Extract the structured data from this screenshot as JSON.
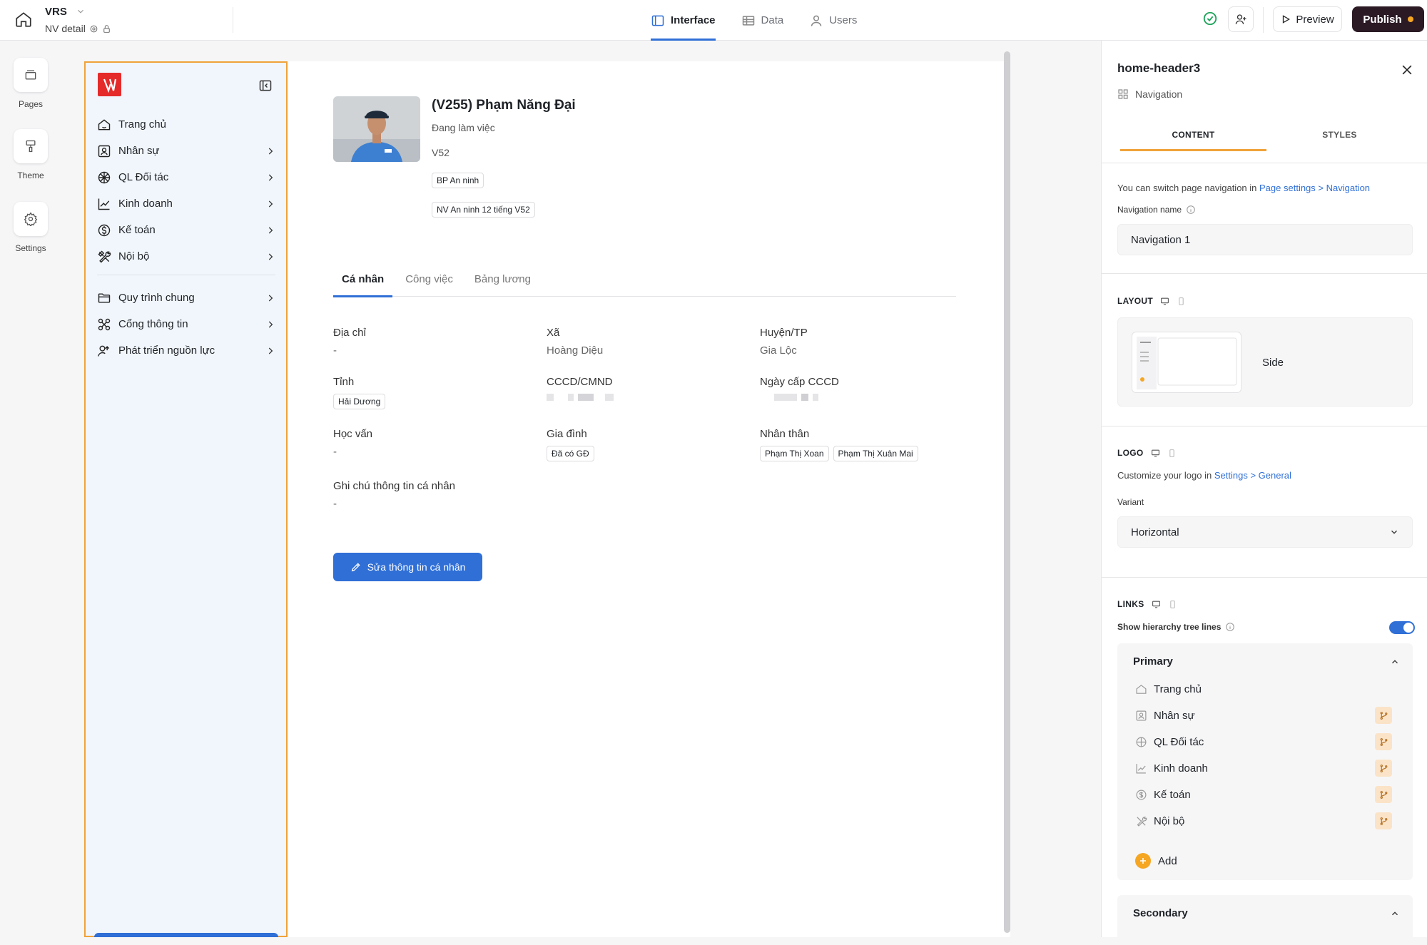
{
  "topbar": {
    "app_name": "VRS",
    "page_name": "NV detail",
    "tabs": [
      {
        "label": "Interface",
        "icon": "layout-icon",
        "active": true
      },
      {
        "label": "Data",
        "icon": "table-icon",
        "active": false
      },
      {
        "label": "Users",
        "icon": "user-icon",
        "active": false
      }
    ],
    "preview_label": "Preview",
    "publish_label": "Publish"
  },
  "rail": {
    "pages": "Pages",
    "theme": "Theme",
    "settings": "Settings"
  },
  "sidenav": {
    "primary": [
      {
        "label": "Trang chủ",
        "icon": "home-icon",
        "chevron": false
      },
      {
        "label": "Nhân sự",
        "icon": "id-card-icon",
        "chevron": true
      },
      {
        "label": "QL Đối tác",
        "icon": "network-icon",
        "chevron": true
      },
      {
        "label": "Kinh doanh",
        "icon": "trend-icon",
        "chevron": true
      },
      {
        "label": "Kế toán",
        "icon": "dollar-icon",
        "chevron": true
      },
      {
        "label": "Nội bộ",
        "icon": "tools-icon",
        "chevron": true
      }
    ],
    "secondary": [
      {
        "label": "Quy trình chung",
        "icon": "folder-icon",
        "chevron": true
      },
      {
        "label": "Cổng thông tin",
        "icon": "hub-icon",
        "chevron": true
      },
      {
        "label": "Phát triển nguồn lực",
        "icon": "user-growth-icon",
        "chevron": true
      }
    ]
  },
  "profile": {
    "name": "(V255) Phạm Năng Đại",
    "status": "Đang làm việc",
    "code": "V52",
    "chips": [
      "BP An ninh",
      "NV An ninh 12 tiếng V52"
    ]
  },
  "profile_tabs": [
    "Cá nhân",
    "Công việc",
    "Bảng lương"
  ],
  "fields": {
    "dia_chi": {
      "label": "Địa chỉ",
      "value": "-"
    },
    "xa": {
      "label": "Xã",
      "value": "Hoàng Diệu"
    },
    "huyen": {
      "label": "Huyện/TP",
      "value": "Gia Lộc"
    },
    "tinh": {
      "label": "Tỉnh",
      "value": "Hải Dương"
    },
    "cccd": {
      "label": "CCCD/CMND"
    },
    "ngay_cap": {
      "label": "Ngày cấp CCCD"
    },
    "hoc_van": {
      "label": "Học vấn",
      "value": "-"
    },
    "gia_dinh": {
      "label": "Gia đình",
      "value": "Đã có GĐ"
    },
    "nhan_than": {
      "label": "Nhân thân",
      "values": [
        "Phạm Thị Xoan",
        "Phạm Thị Xuân Mai"
      ]
    },
    "ghi_chu": {
      "label": "Ghi chú thông tin cá nhân",
      "value": "-"
    }
  },
  "edit_button": "Sửa thông tin cá nhân",
  "panel": {
    "title": "home-header3",
    "subtitle": "Navigation",
    "tabs": [
      "CONTENT",
      "STYLES"
    ],
    "nav_hint_prefix": "You can switch page navigation in",
    "nav_hint_link": "Page settings > Navigation",
    "nav_name_label": "Navigation name",
    "nav_name_value": "Navigation 1",
    "layout_label": "LAYOUT",
    "layout_value": "Side",
    "logo_label": "LOGO",
    "logo_hint_prefix": "Customize your logo in",
    "logo_hint_link": "Settings > General",
    "variant_label": "Variant",
    "variant_value": "Horizontal",
    "links_label": "LINKS",
    "tree_lines_label": "Show hierarchy tree lines",
    "tree_lines_on": true,
    "primary_title": "Primary",
    "primary_links": [
      "Trang chủ",
      "Nhân sự",
      "QL Đối tác",
      "Kinh doanh",
      "Kế toán",
      "Nội bộ"
    ],
    "add_label": "Add",
    "secondary_title": "Secondary"
  },
  "colors": {
    "accent": "#2f6fd6",
    "selection_outline": "#f0a33a",
    "publish_bg": "#2b1a24",
    "logo_red": "#e52a2a"
  }
}
